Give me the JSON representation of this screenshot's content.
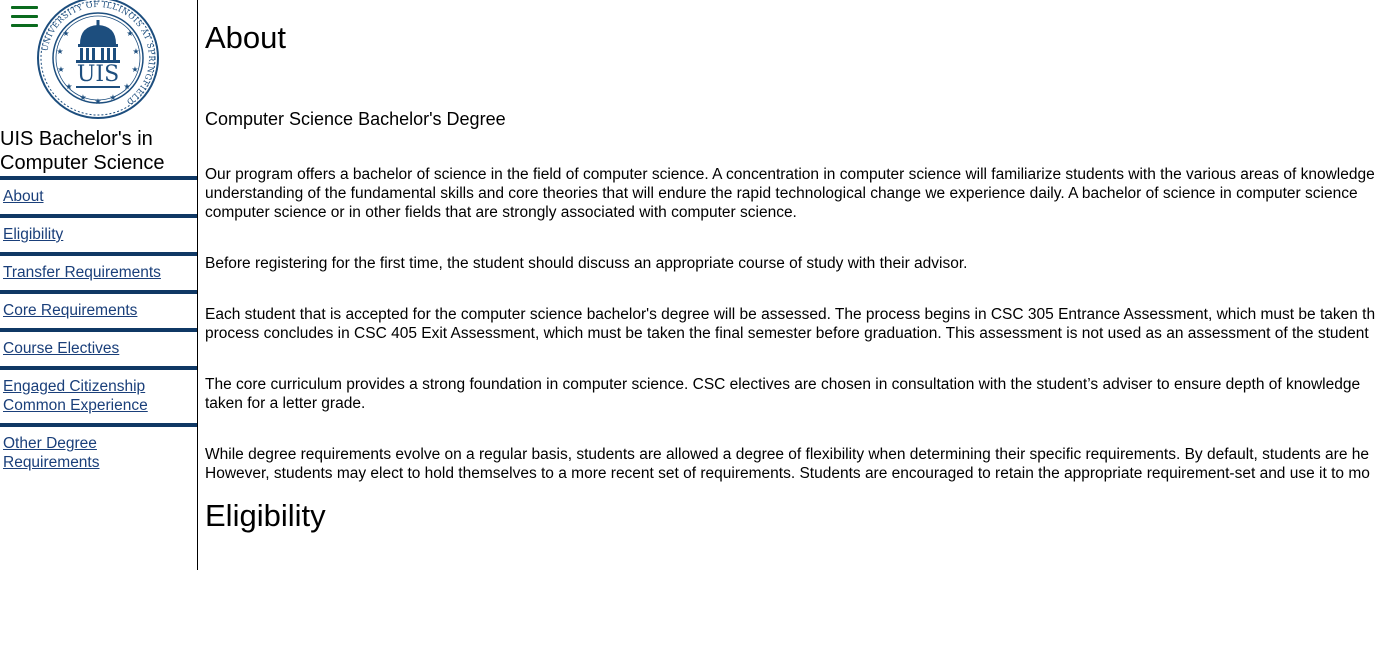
{
  "sidebar": {
    "title_line1": "UIS Bachelor's in",
    "title_line2": "Computer Science",
    "seal_text": "UIS",
    "seal_ring_text": "UNIVERSITY OF ILLINOIS AT SPRINGFIELD",
    "menu_icon": "hamburger-menu-icon",
    "nav": [
      {
        "label_lines": [
          "About"
        ]
      },
      {
        "label_lines": [
          "Eligibility"
        ]
      },
      {
        "label_lines": [
          "Transfer Requirements"
        ]
      },
      {
        "label_lines": [
          "Core Requirements"
        ]
      },
      {
        "label_lines": [
          "Course Electives"
        ]
      },
      {
        "label_lines": [
          "Engaged Citizenship",
          "Common Experience"
        ]
      },
      {
        "label_lines": [
          "Other Degree",
          "Requirements"
        ]
      }
    ]
  },
  "main": {
    "heading_about": "About",
    "subheading": "Computer Science Bachelor's Degree",
    "paragraphs": [
      {
        "lines": [
          "Our program offers a bachelor of science in the field of computer science. A concentration in computer science will familiarize students with the various areas of knowledge",
          "understanding of the fundamental skills and core theories that will endure the rapid technological change we experience daily. A bachelor of science in computer science",
          "computer science or in other fields that are strongly associated with computer science."
        ]
      },
      {
        "lines": [
          "Before registering for the first time, the student should discuss an appropriate course of study with their advisor."
        ]
      },
      {
        "lines": [
          "Each student that is accepted for the computer science bachelor's degree will be assessed. The process begins in CSC 305 Entrance Assessment, which must be taken th",
          "process concludes in CSC 405 Exit Assessment, which must be taken the final semester before graduation. This assessment is not used as an assessment of the student"
        ]
      },
      {
        "lines": [
          "The core curriculum provides a strong foundation in computer science. CSC electives are chosen in consultation with the student’s adviser to ensure depth of knowledge",
          "taken for a letter grade."
        ]
      },
      {
        "lines": [
          "While degree requirements evolve on a regular basis, students are allowed a degree of flexibility when determining their specific requirements. By default, students are he",
          "However, students may elect to hold themselves to a more recent set of requirements. Students are encouraged to retain the appropriate requirement-set and use it to mo"
        ]
      }
    ],
    "heading_eligibility": "Eligibility"
  },
  "colors": {
    "nav_border": "#0f3864",
    "link": "#1a3f7a",
    "menu_icon": "#0a6b1e",
    "seal": "#1d4e7e"
  }
}
